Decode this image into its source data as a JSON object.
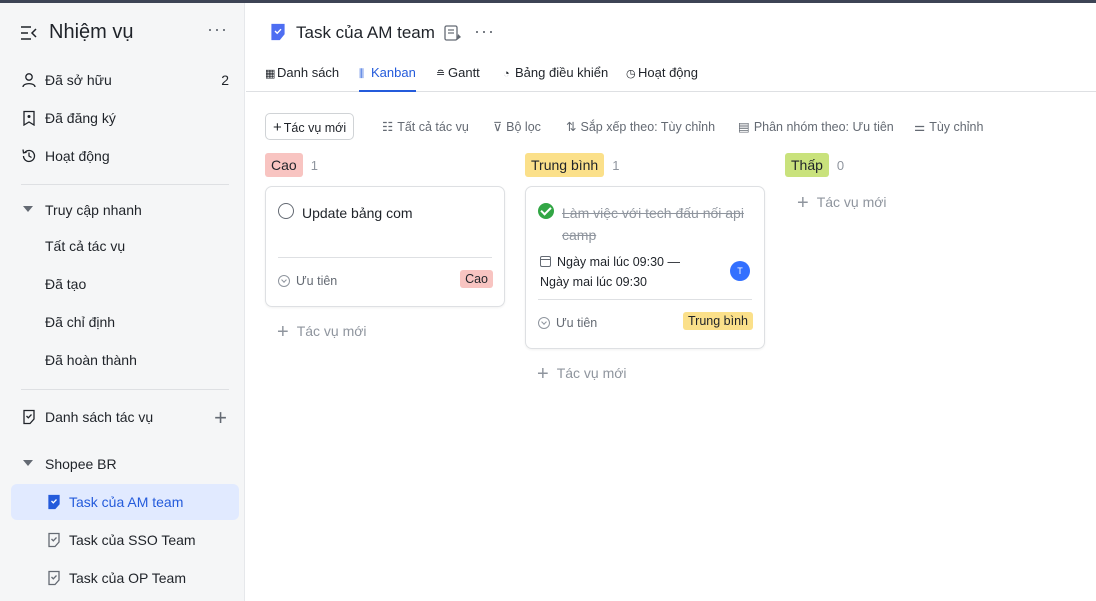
{
  "sidebar": {
    "title": "Nhiệm vụ",
    "more": "···",
    "items": [
      {
        "label": "Đã sở hữu",
        "count": "2"
      },
      {
        "label": "Đã đăng ký"
      },
      {
        "label": "Hoạt động"
      }
    ],
    "quick_access": {
      "label": "Truy cập nhanh",
      "items": [
        "Tất cả tác vụ",
        "Đã tạo",
        "Đã chỉ định",
        "Đã hoàn thành"
      ]
    },
    "task_lists": {
      "label": "Danh sách tác vụ"
    },
    "group": {
      "label": "Shopee BR",
      "items": [
        "Task của AM team",
        "Task của SSO Team",
        "Task của OP Team"
      ]
    }
  },
  "header": {
    "title": "Task của AM team",
    "more": "···"
  },
  "tabs": [
    {
      "label": "Danh sách"
    },
    {
      "label": "Kanban"
    },
    {
      "label": "Gantt"
    },
    {
      "label": "Bảng điều khiển"
    },
    {
      "label": "Hoạt động"
    }
  ],
  "toolbar": {
    "new_task": "Tác vụ mới",
    "all_tasks": "Tất cả tác vụ",
    "filter": "Bộ lọc",
    "sort": "Sắp xếp theo: Tùy chỉnh",
    "group_by": "Phân nhóm theo: Ưu tiên",
    "customize": "Tùy chỉnh"
  },
  "columns": [
    {
      "label": "Cao",
      "count": "1",
      "color": "#f8c4c1"
    },
    {
      "label": "Trung bình",
      "count": "1",
      "color": "#fbe08a"
    },
    {
      "label": "Thấp",
      "count": "0",
      "color": "#c9e27c"
    }
  ],
  "cards": [
    {
      "title": "Update bảng com",
      "priority_label": "Ưu tiên",
      "badge": "Cao",
      "badge_color": "#f8c4c1",
      "done": false
    },
    {
      "title": "Làm việc với tech đấu nối api camp",
      "date_line1": "Ngày mai lúc 09:30  —",
      "date_line2": "Ngày mai lúc 09:30",
      "avatar": "T",
      "priority_label": "Ưu tiên",
      "badge": "Trung bình",
      "badge_color": "#fbe08a",
      "done": true
    }
  ],
  "add_task_label": "Tác vụ mới"
}
